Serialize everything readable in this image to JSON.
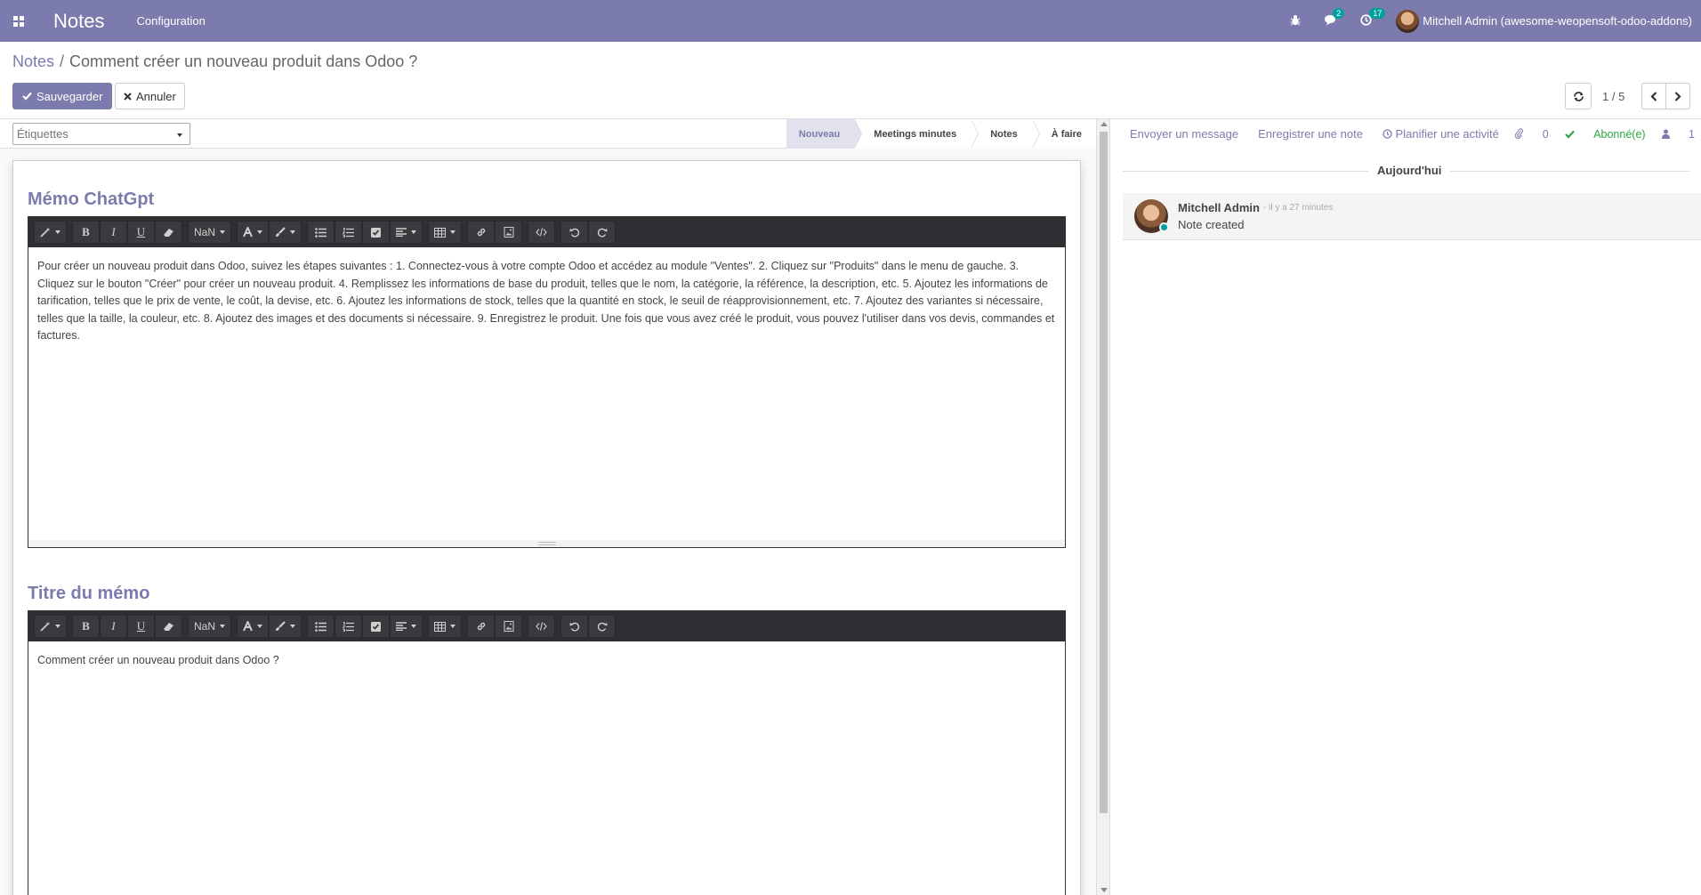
{
  "navbar": {
    "brand": "Notes",
    "menu": "Configuration",
    "messages_badge": "2",
    "activities_badge": "17",
    "user": "Mitchell Admin (awesome-weopensoft-odoo-addons)"
  },
  "control_panel": {
    "breadcrumb_root": "Notes",
    "breadcrumb_sep": "/",
    "breadcrumb_current": "Comment créer un nouveau produit dans Odoo ?",
    "save_label": "Sauvegarder",
    "cancel_label": "Annuler",
    "pager_value": "1 / 5"
  },
  "form": {
    "tags_placeholder": "Étiquettes",
    "stages": [
      "Nouveau",
      "Meetings minutes",
      "Notes",
      "À faire"
    ],
    "active_stage": "Nouveau",
    "field1_label": "Mémo ChatGpt",
    "field1_content": "Pour créer un nouveau produit dans Odoo, suivez les étapes suivantes : 1. Connectez-vous à votre compte Odoo et accédez au module \"Ventes\". 2. Cliquez sur \"Produits\" dans le menu de gauche. 3. Cliquez sur le bouton \"Créer\" pour créer un nouveau produit. 4. Remplissez les informations de base du produit, telles que le nom, la catégorie, la référence, la description, etc. 5. Ajoutez les informations de tarification, telles que le prix de vente, le coût, la devise, etc. 6. Ajoutez les informations de stock, telles que la quantité en stock, le seuil de réapprovisionnement, etc. 7. Ajoutez des variantes si nécessaire, telles que la taille, la couleur, etc. 8. Ajoutez des images et des documents si nécessaire. 9. Enregistrez le produit. Une fois que vous avez créé le produit, vous pouvez l'utiliser dans vos devis, commandes et factures.",
    "field2_label": "Titre du mémo",
    "field2_content": "Comment créer un nouveau produit dans Odoo ?",
    "toolbar_fontsize": "NaN"
  },
  "chatter": {
    "send_message": "Envoyer un message",
    "log_note": "Enregistrer une note",
    "schedule_activity": "Planifier une activité",
    "attachments_count": "0",
    "subscribed": "Abonné(e)",
    "followers_count": "1",
    "date_separator": "Aujourd'hui",
    "messages": [
      {
        "author": "Mitchell Admin",
        "date": "- il y a 27 minutes",
        "body": "Note created"
      }
    ]
  },
  "colors": {
    "brand": "#7c7bad",
    "accent": "#00a09d",
    "subscribed": "#28a745"
  }
}
